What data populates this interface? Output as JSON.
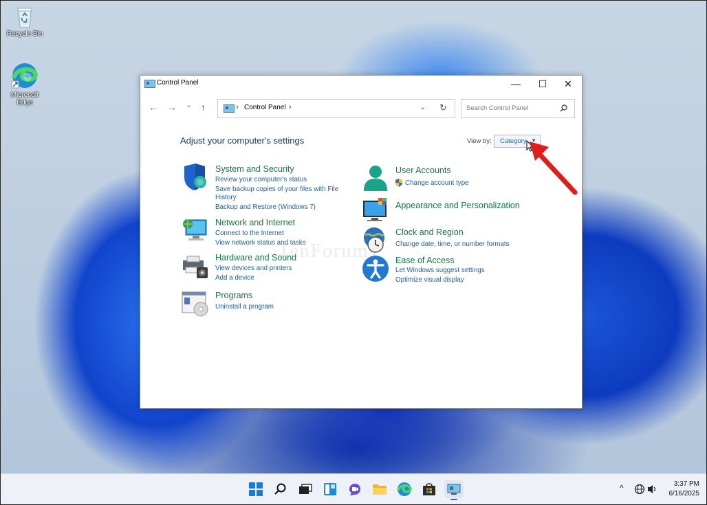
{
  "desktop": {
    "recycle_bin_label": "Recycle Bin",
    "edge_label": "Microsoft Edge"
  },
  "window": {
    "title": "Control Panel",
    "minimize": "—",
    "maximize": "☐",
    "close": "✕"
  },
  "nav": {
    "back": "←",
    "forward": "→",
    "recent": "⌄",
    "up": "↑"
  },
  "address": {
    "crumb_sep": "›",
    "crumb": "Control Panel",
    "crumb_sep2": "›",
    "dropdown": "⌄",
    "refresh": "↻"
  },
  "search": {
    "placeholder": "Search Control Panel"
  },
  "heading": "Adjust your computer's settings",
  "view_by": {
    "label": "View by:",
    "value": "Category"
  },
  "watermark": "TenForums",
  "categories": {
    "system_security": {
      "title": "System and Security",
      "link1": "Review your computer's status",
      "link2a": "Save backup copies of your files with File",
      "link2b": "History",
      "link3": "Backup and Restore (Windows 7)"
    },
    "network": {
      "title": "Network and Internet",
      "link1": "Connect to the Internet",
      "link2": "View network status and tasks"
    },
    "hardware": {
      "title": "Hardware and Sound",
      "link1": "View devices and printers",
      "link2": "Add a device"
    },
    "programs": {
      "title": "Programs",
      "link1": "Uninstall a program"
    },
    "user_accounts": {
      "title": "User Accounts",
      "link1": "Change account type"
    },
    "appearance": {
      "title": "Appearance and Personalization"
    },
    "clock": {
      "title": "Clock and Region",
      "link1": "Change date, time, or number formats"
    },
    "ease": {
      "title": "Ease of Access",
      "link1": "Let Windows suggest settings",
      "link2": "Optimize visual display"
    }
  },
  "taskbar": {
    "chevron": "^",
    "time": "3:37 PM",
    "date": "6/16/2025"
  },
  "colors": {
    "link_blue": "#1e5fa8",
    "category_green": "#157a43",
    "heading_navy": "#1e3a6e",
    "annotation_red": "#e21b1b"
  }
}
